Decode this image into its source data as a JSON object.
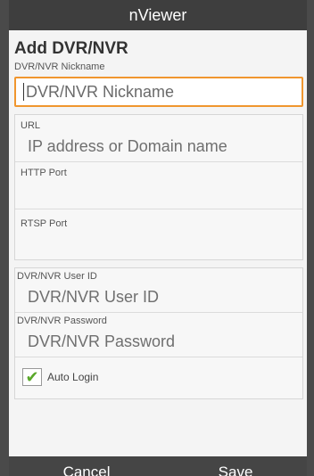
{
  "app": {
    "title": "nViewer"
  },
  "form": {
    "heading": "Add DVR/NVR",
    "nickname": {
      "label": "DVR/NVR Nickname",
      "placeholder": "DVR/NVR Nickname"
    },
    "url": {
      "label": "URL",
      "placeholder": "IP address or Domain name"
    },
    "http_port": {
      "label": "HTTP Port",
      "value": ""
    },
    "rtsp_port": {
      "label": "RTSP Port",
      "value": ""
    },
    "user_id": {
      "label": "DVR/NVR User ID",
      "placeholder": "DVR/NVR User ID"
    },
    "password": {
      "label": "DVR/NVR Password",
      "placeholder": "DVR/NVR Password"
    },
    "auto_login": {
      "label": "Auto Login",
      "checked": true
    }
  },
  "actions": {
    "cancel": "Cancel",
    "save": "Save"
  },
  "colors": {
    "focus_border": "#f0962e",
    "check": "#5aa82a",
    "titlebar": "#3e3e3e"
  }
}
